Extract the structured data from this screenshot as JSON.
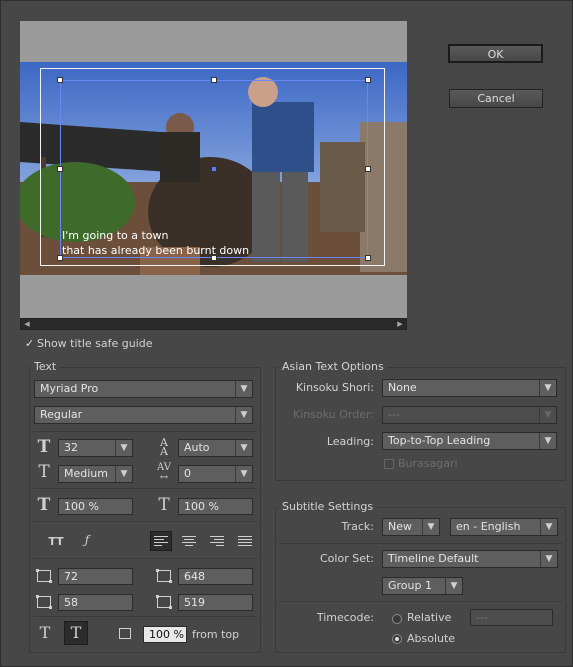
{
  "buttons": {
    "ok": "OK",
    "cancel": "Cancel"
  },
  "preview": {
    "subtitle_line1": "I'm going to a town",
    "subtitle_line2": "that has already been burnt down"
  },
  "safe_guide": {
    "checked": true,
    "label": "Show title safe guide"
  },
  "text_group": {
    "title": "Text",
    "font": "Myriad Pro",
    "style": "Regular",
    "size": "32",
    "leading": "Auto",
    "weight": "Medium",
    "tracking": "0",
    "horizontal_scale": "100 %",
    "vertical_scale": "100 %",
    "tt_label": "TT",
    "left": "72",
    "right": "648",
    "top": "58",
    "bottom": "519",
    "bottom_offset": "100 %",
    "from_top_label": "from top"
  },
  "asian_options": {
    "title": "Asian Text Options",
    "kinsoku_shori_label": "Kinsoku Shori:",
    "kinsoku_shori_value": "None",
    "kinsoku_order_label": "Kinsoku Order:",
    "kinsoku_order_value": "---",
    "leading_label": "Leading:",
    "leading_value": "Top-to-Top Leading",
    "burasagari_label": "Burasagari"
  },
  "subtitle_settings": {
    "title": "Subtitle Settings",
    "track_label": "Track:",
    "track_value": "New",
    "language_value": "en - English",
    "color_set_label": "Color Set:",
    "color_set_value": "Timeline Default",
    "group_value": "Group 1",
    "timecode_label": "Timecode:",
    "relative_label": "Relative",
    "relative_value": "---",
    "absolute_label": "Absolute",
    "selected_timecode": "Absolute"
  }
}
